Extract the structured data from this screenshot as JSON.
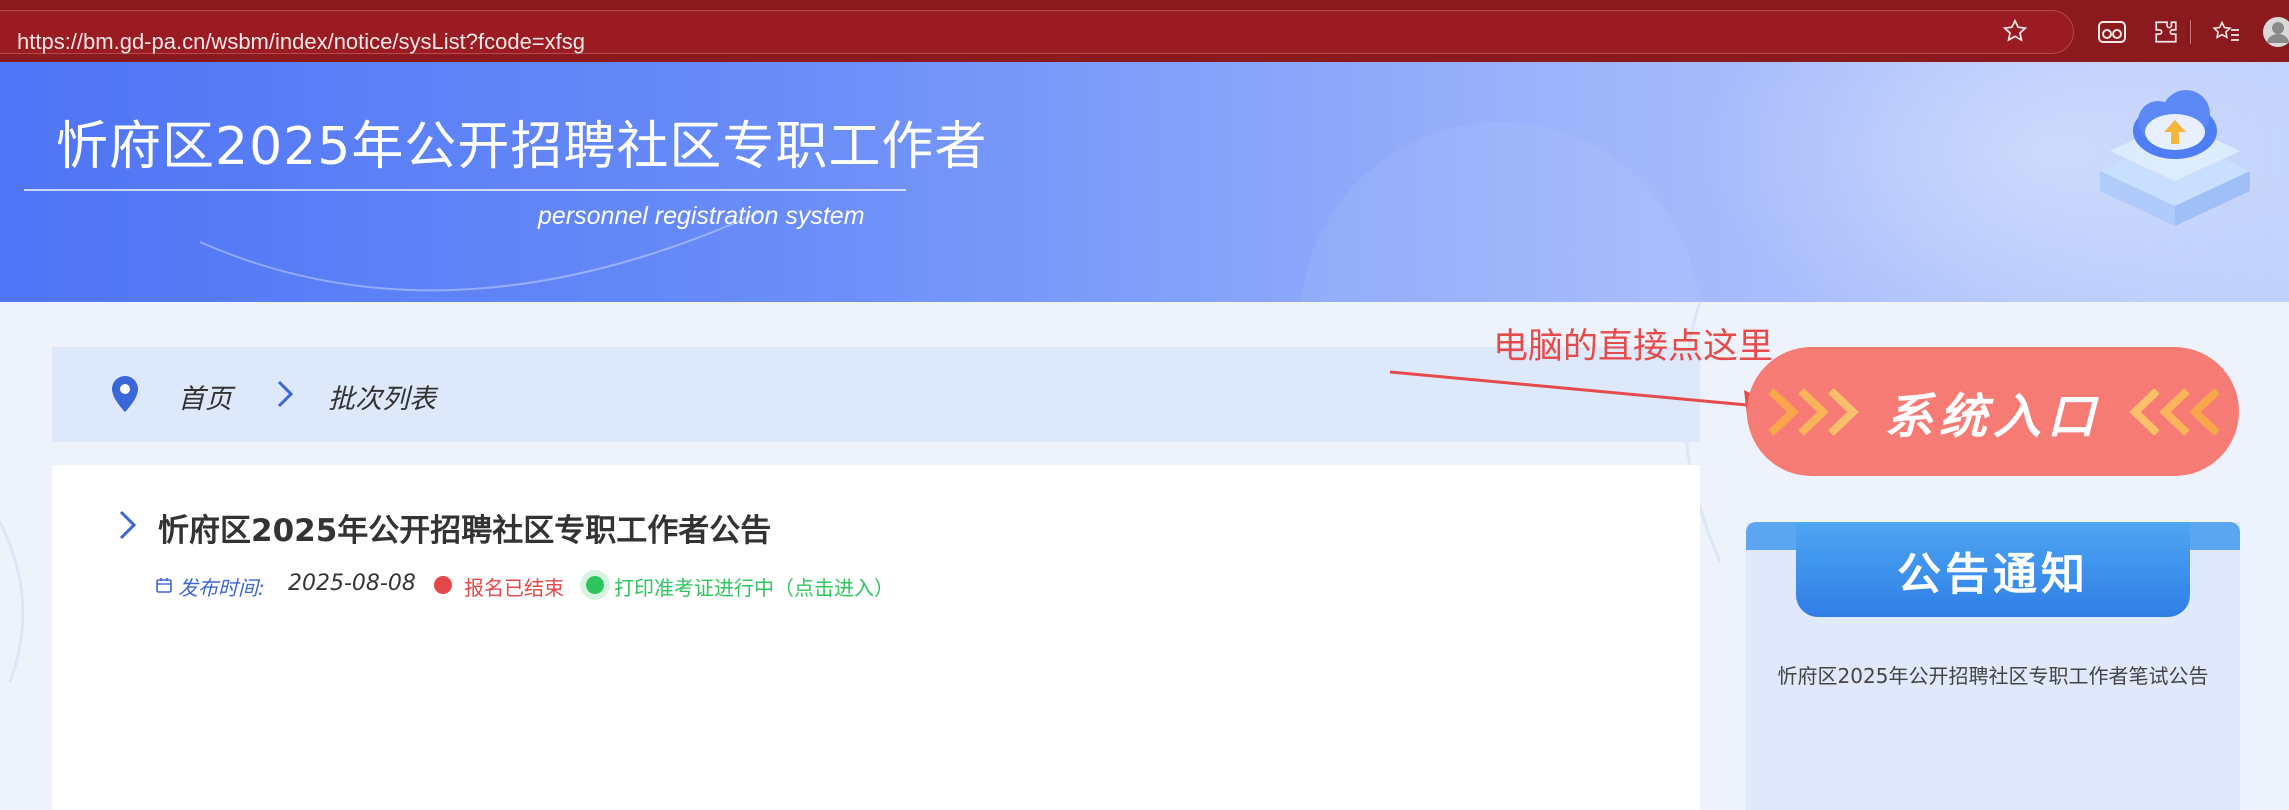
{
  "browser": {
    "url": "https://bm.gd-pa.cn/wsbm/index/notice/sysList?fcode=xfsg",
    "icons": [
      "lock-icon",
      "star-icon",
      "glasses-icon",
      "extensions-icon",
      "favorites-icon",
      "profile-icon"
    ]
  },
  "banner": {
    "title": "忻府区2025年公开招聘社区专职工作者",
    "subtitle": "personnel registration system",
    "logo": "cloud-upload-icon"
  },
  "breadcrumb": {
    "home": "首页",
    "current": "批次列表"
  },
  "list": {
    "items": [
      {
        "title": "忻府区2025年公开招聘社区专职工作者公告",
        "publish_label": "发布时间:",
        "publish_date": "2025-08-08",
        "status_ended": "报名已结束",
        "status_print": "打印准考证进行中（点击进入）"
      }
    ]
  },
  "annotation": {
    "text": "电脑的直接点这里"
  },
  "sidebar": {
    "entry_label": "系统入口",
    "notice_title": "公告通知",
    "notice_items": [
      "忻府区2025年公开招聘社区专职工作者笔试公告"
    ]
  },
  "colors": {
    "browser_bar": "#8b1a1f",
    "banner_start": "#4f74f6",
    "accent_blue": "#3b66d8",
    "status_red": "#e54848",
    "status_green": "#2ec55d",
    "entry_button": "#f67b75",
    "annotation_red": "#e54b4b"
  }
}
